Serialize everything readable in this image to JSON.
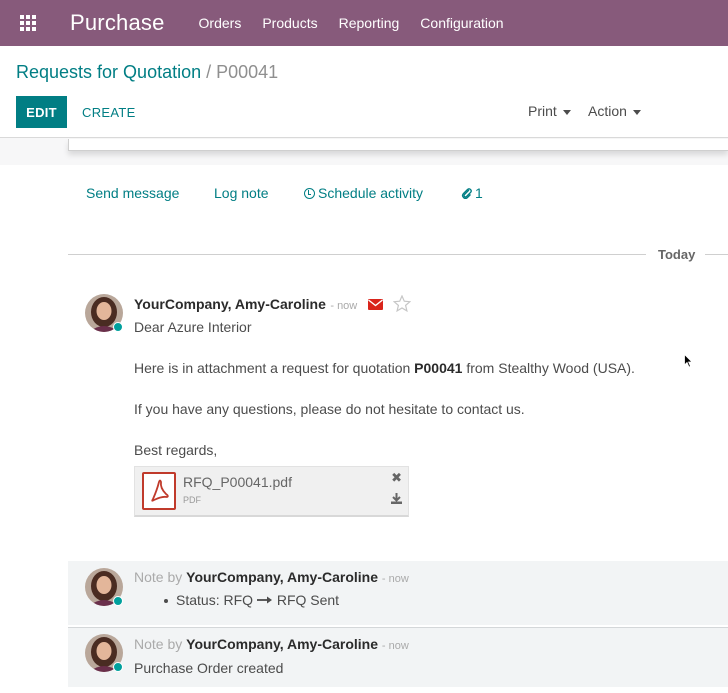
{
  "app": {
    "name": "Purchase"
  },
  "menu": [
    "Orders",
    "Products",
    "Reporting",
    "Configuration"
  ],
  "breadcrumb": {
    "parent": "Requests for Quotation",
    "separator": "/",
    "current": "P00041"
  },
  "buttons": {
    "edit": "EDIT",
    "create": "CREATE",
    "print": "Print",
    "action": "Action"
  },
  "chatter": {
    "send_message": "Send message",
    "log_note": "Log note",
    "schedule_activity": "Schedule activity",
    "attachment_count": "1",
    "date_separator": "Today"
  },
  "message": {
    "author": "YourCompany, Amy-Caroline",
    "time": "- now",
    "greeting": "Dear Azure Interior",
    "line1_pre": "Here is in attachment a request for quotation ",
    "line1_bold": "P00041",
    "line1_post": " from Stealthy Wood (USA).",
    "line2": "If you have any questions, please do not hesitate to contact us.",
    "line3": "Best regards,",
    "attachment": {
      "name": "RFQ_P00041.pdf",
      "type": "PDF"
    }
  },
  "notes": [
    {
      "prefix": "Note by",
      "author": "YourCompany, Amy-Caroline",
      "time": "- now",
      "tracking_label": "Status:",
      "old_value": "RFQ",
      "new_value": "RFQ Sent"
    },
    {
      "prefix": "Note by",
      "author": "YourCompany, Amy-Caroline",
      "time": "- now",
      "body": "Purchase Order created"
    }
  ],
  "colors": {
    "navbar": "#875a7b",
    "primary": "#017e84",
    "presence": "#00a09d",
    "envelope": "#d9241b",
    "pdf": "#c03a2b"
  }
}
